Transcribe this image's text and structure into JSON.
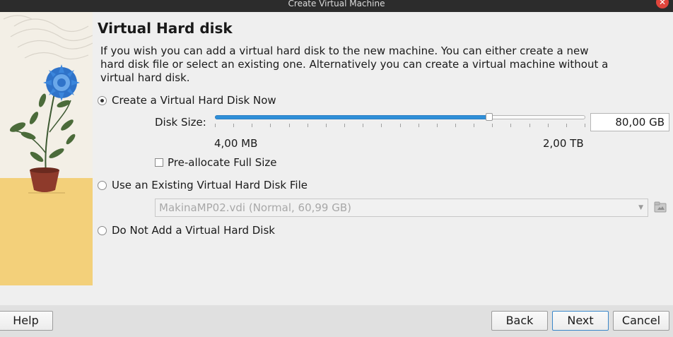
{
  "window": {
    "title": "Create Virtual Machine"
  },
  "page": {
    "heading": "Virtual Hard disk",
    "description": "If you wish you can add a virtual hard disk to the new machine. You can either create a new hard disk file or select an existing one. Alternatively you can create a virtual machine without a virtual hard disk."
  },
  "options": {
    "create_now": {
      "label": "Create a Virtual Hard Disk Now",
      "selected": true
    },
    "use_existing": {
      "label": "Use an Existing Virtual Hard Disk File",
      "selected": false
    },
    "no_disk": {
      "label": "Do Not Add a Virtual Hard Disk",
      "selected": false
    }
  },
  "disk_size": {
    "label": "Disk Size:",
    "value": "80,00 GB",
    "min_label": "4,00 MB",
    "max_label": "2,00 TB",
    "slider_fraction": 0.74
  },
  "preallocate": {
    "label": "Pre-allocate Full Size",
    "checked": false
  },
  "existing_file": {
    "selected": "MakinaMP02.vdi (Normal, 60,99 GB)"
  },
  "buttons": {
    "help": "Help",
    "back": "Back",
    "next": "Next",
    "cancel": "Cancel"
  },
  "colors": {
    "accent": "#2f8fd8",
    "close": "#e0453c",
    "art_yellow": "#f3d07a"
  }
}
